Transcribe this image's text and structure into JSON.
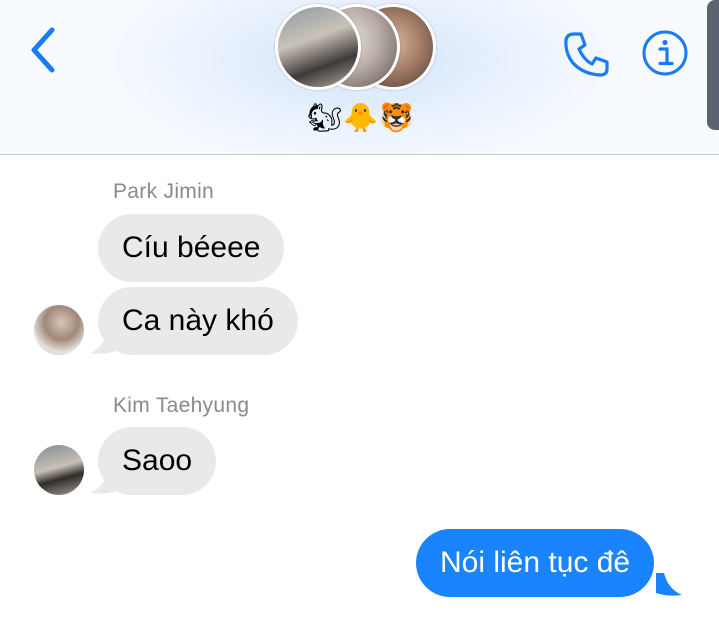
{
  "header": {
    "group_emoji": "🐿🐥🐯",
    "back": "back",
    "icons": {
      "back": "chevron-left-icon",
      "call": "phone-icon",
      "info": "info-icon"
    },
    "accent": "#1a7cf5"
  },
  "messages": [
    {
      "sender": "Park Jimin",
      "text": "Cíu béeee",
      "direction": "incoming"
    },
    {
      "sender": "Park Jimin",
      "text": "Ca này khó",
      "direction": "incoming"
    },
    {
      "sender": "Kim Taehyung",
      "text": "Saoo",
      "direction": "incoming"
    },
    {
      "sender": "me",
      "text": "Nói liên tục đê",
      "direction": "outgoing"
    }
  ],
  "colors": {
    "incoming_bubble": "#e9e9eb",
    "outgoing_bubble": "#1a84ff",
    "sender_name": "#8a8a8e"
  }
}
